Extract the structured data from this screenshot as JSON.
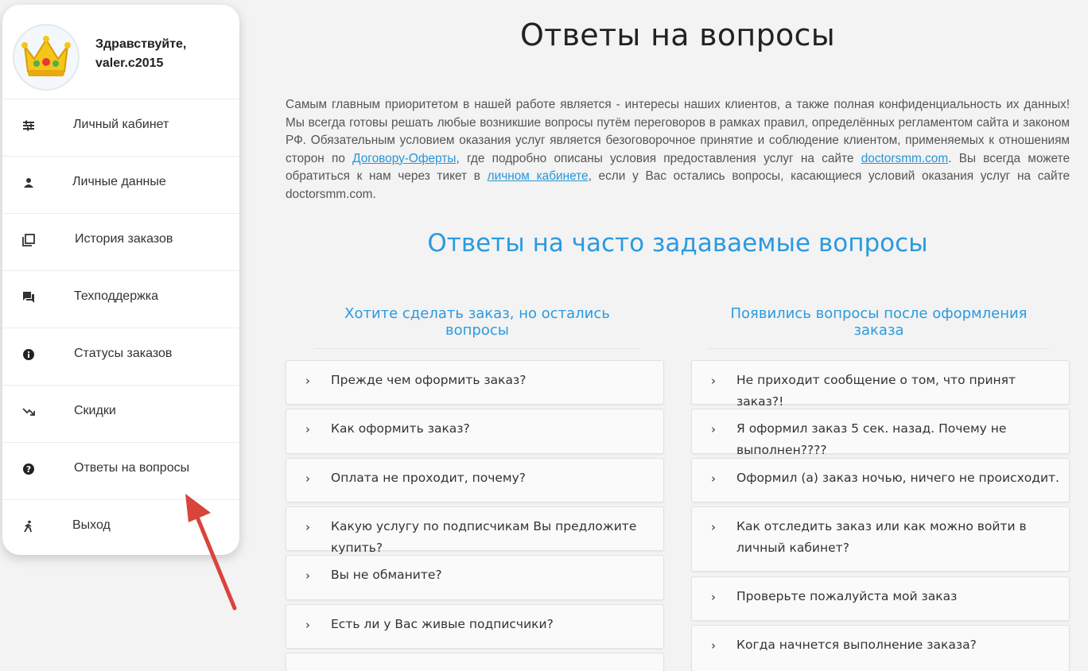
{
  "sidebar": {
    "greeting": "Здравствуйте,",
    "username": "valer.c2015",
    "items": [
      {
        "label": "Личный кабинет",
        "icon": "sliders-icon"
      },
      {
        "label": "Личные данные",
        "icon": "person-icon"
      },
      {
        "label": "История заказов",
        "icon": "library-icon"
      },
      {
        "label": "Техподдержка",
        "icon": "chat-icon"
      },
      {
        "label": "Статусы заказов",
        "icon": "info-icon"
      },
      {
        "label": "Скидки",
        "icon": "trending-down-icon"
      },
      {
        "label": "Ответы на вопросы",
        "icon": "help-icon"
      },
      {
        "label": "Выход",
        "icon": "walk-icon"
      }
    ]
  },
  "main": {
    "title": "Ответы на вопросы",
    "intro": {
      "part1": "Самым главным приоритетом в нашей работе является - интересы наших клиентов, а также полная конфиденциальность их данных! Мы всегда готовы решать любые возникшие вопросы путём переговоров в рамках правил, определённых регламентом сайта и законом РФ. Обязательным условием оказания услуг является безоговорочное принятие и соблюдение клиентом, применяемых к отношениям сторон по ",
      "link1": "Договору-Оферты",
      "part2": ", где подробно описаны условия предоставления услуг на сайте ",
      "link2": "doctorsmm.com",
      "part3": ". Вы всегда можете обратиться к нам через тикет в ",
      "link3": "личном кабинете",
      "part4": ", если у Вас остались вопросы, касающиеся условий оказания услуг на сайте doctorsmm.com."
    },
    "faq_title": "Ответы на часто задаваемые вопросы",
    "left_column": {
      "title": "Хотите сделать заказ, но остались вопросы",
      "questions": [
        "Прежде чем оформить заказ?",
        "Как оформить заказ?",
        "Оплата не проходит, почему?",
        "Какую услугу по подписчикам Вы предложите купить?",
        "Вы не обманите?",
        "Есть ли у Вас живые подписчики?",
        ""
      ]
    },
    "right_column": {
      "title": "Появились вопросы после оформления заказа",
      "questions": [
        "Не приходит сообщение о том, что принят заказ?!",
        "Я оформил заказ 5 сек. назад. Почему не выполнен????",
        "Оформил (а) заказ ночью, ничего не происходит.",
        "Как отследить заказ или как можно войти в личный кабинет?",
        "Проверьте пожалуйста мой заказ",
        "Когда начнется выполнение заказа?"
      ]
    },
    "chevron": "›"
  },
  "colors": {
    "accent": "#2b9ae0",
    "link": "#2596d8",
    "annotation_arrow": "#d9443b"
  }
}
